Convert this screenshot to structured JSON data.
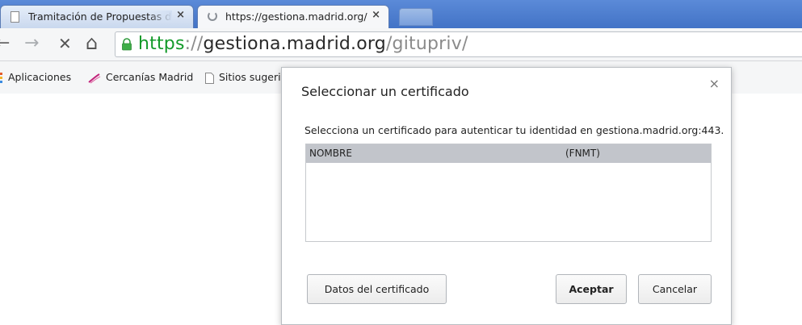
{
  "tabs": [
    {
      "title": "Tramitación de Propuestas d",
      "close": "×"
    },
    {
      "title": "https://gestiona.madrid.org/",
      "close": "×"
    }
  ],
  "toolbar": {
    "back_glyph": "←",
    "forward_glyph": "→",
    "stop_glyph": "✕",
    "home_glyph": "⌂",
    "url_scheme": "https",
    "url_sep": "://",
    "url_host": "gestiona.madrid.org",
    "url_path": "/gitupriv/"
  },
  "bookmarks": {
    "items": [
      {
        "label": "Aplicaciones"
      },
      {
        "label": "Cercanías Madrid"
      },
      {
        "label": "Sitios sugeri"
      }
    ]
  },
  "dialog": {
    "title": "Seleccionar un certificado",
    "close": "×",
    "message": "Selecciona un certificado para autenticar tu identidad en gestiona.madrid.org:443.",
    "certificates": [
      {
        "name": "NOMBRE",
        "issuer": "(FNMT)"
      }
    ],
    "buttons": {
      "details": "Datos del certificado",
      "accept": "Aceptar",
      "cancel": "Cancelar"
    }
  },
  "colors": {
    "tabstrip": "#4f7fd2",
    "secure_green": "#139a2a",
    "selected_row": "#c2c5cb"
  }
}
